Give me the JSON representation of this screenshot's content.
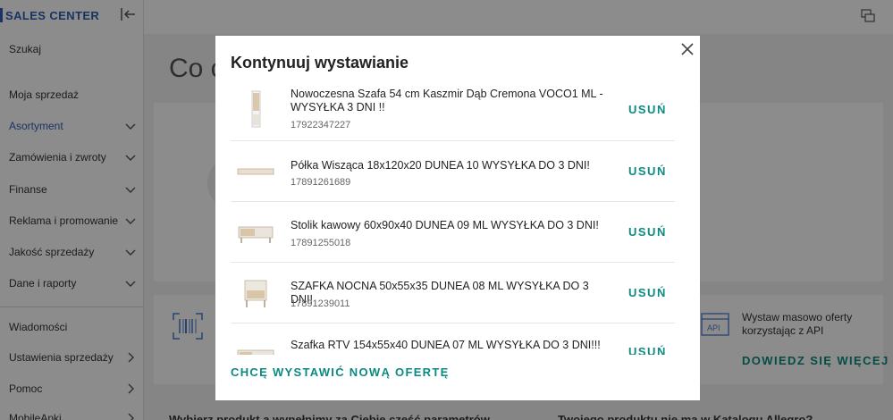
{
  "sidebar": {
    "brand": "SALES CENTER",
    "items": [
      {
        "label": "Szukaj"
      },
      {
        "label": "Moja sprzedaż"
      },
      {
        "label": "Asortyment"
      },
      {
        "label": "Zamówienia i zwroty"
      },
      {
        "label": "Finanse"
      },
      {
        "label": "Reklama i promowanie"
      },
      {
        "label": "Jakość sprzedaży"
      },
      {
        "label": "Dane i raporty"
      },
      {
        "label": "Wiadomości"
      },
      {
        "label": "Ustawienia sprzedaży"
      },
      {
        "label": "Pomoc"
      },
      {
        "label": "MobileApki"
      }
    ]
  },
  "background": {
    "heading": "Co c",
    "api_text": "Wystaw masowo oferty korzystając z API",
    "api_link": "DOWIEDZ SIĘ WIĘCEJ",
    "bottom_left": "Wybierz produkt a wypełnimy za Ciebie część parametrów",
    "bottom_right": "Twojego produktu nie ma w Katalogu Allegro?",
    "api_icon_label": "API"
  },
  "modal": {
    "title": "Kontynuuj wystawianie",
    "remove_label": "USUŃ",
    "new_offer_link": "CHCĘ WYSTAWIĆ NOWĄ OFERTĘ",
    "items": [
      {
        "title": "Nowoczesna Szafa 54 cm Kaszmir Dąb Cremona VOCO1 ML - WYSYŁKA 3 DNI !!",
        "id": "17922347227"
      },
      {
        "title": "Półka Wisząca 18x120x20 DUNEA 10 WYSYŁKA DO 3 DNI!",
        "id": "17891261689"
      },
      {
        "title": "Stolik kawowy 60x90x40 DUNEA 09 ML WYSYŁKA DO 3 DNI!",
        "id": "17891255018"
      },
      {
        "title": "SZAFKA NOCNA 50x55x35 DUNEA 08 ML WYSYŁKA DO 3 DNI!",
        "id": "17891239011"
      },
      {
        "title": "Szafka RTV 154x55x40 DUNEA 07 ML WYSYŁKA DO 3 DNI!!!",
        "id": ""
      }
    ]
  },
  "colors": {
    "accent": "#0b8a80",
    "brand": "#2f5fb3"
  }
}
